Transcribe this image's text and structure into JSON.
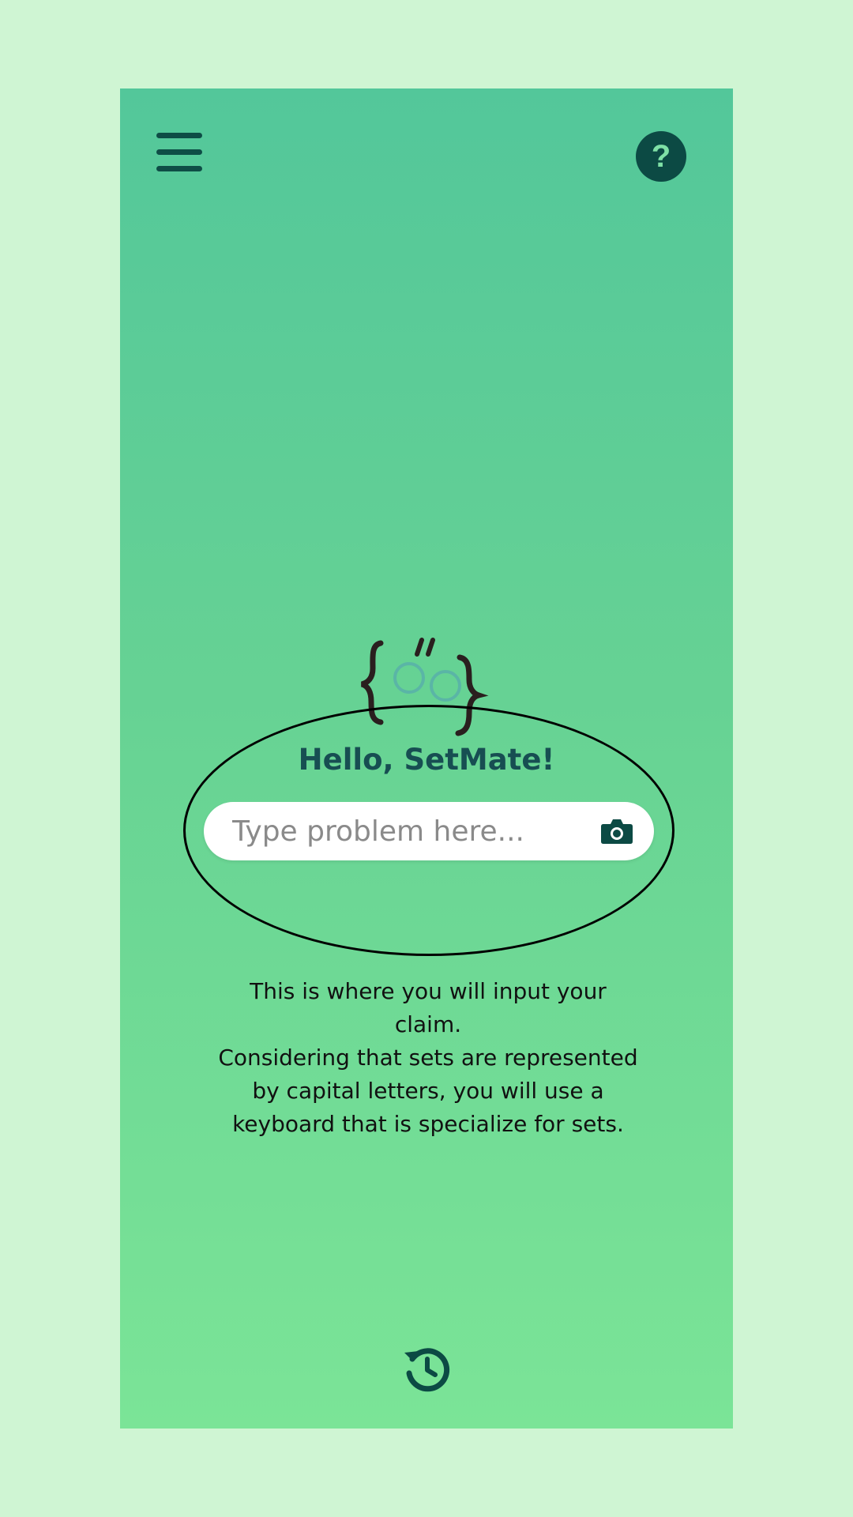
{
  "header": {
    "menu_icon": "hamburger-menu-icon",
    "help_icon": "question-mark-icon",
    "help_glyph": "?"
  },
  "logo": {
    "icon": "setmate-logo-icon"
  },
  "main": {
    "greeting": "Hello, SetMate!",
    "search": {
      "placeholder": "Type problem here...",
      "value": "",
      "camera_icon": "camera-icon"
    }
  },
  "tutorial": {
    "line1": "This is where you will input your claim.",
    "line2": "Considering that sets are represented by capital letters, you will use a keyboard that is specialize for sets."
  },
  "footer": {
    "history_icon": "history-icon"
  },
  "colors": {
    "page_background": "#cff5d3",
    "gradient_top": "#53c79a",
    "gradient_bottom": "#7be497",
    "icon_dark": "#0e4d46",
    "greeting_text": "#174e52"
  }
}
